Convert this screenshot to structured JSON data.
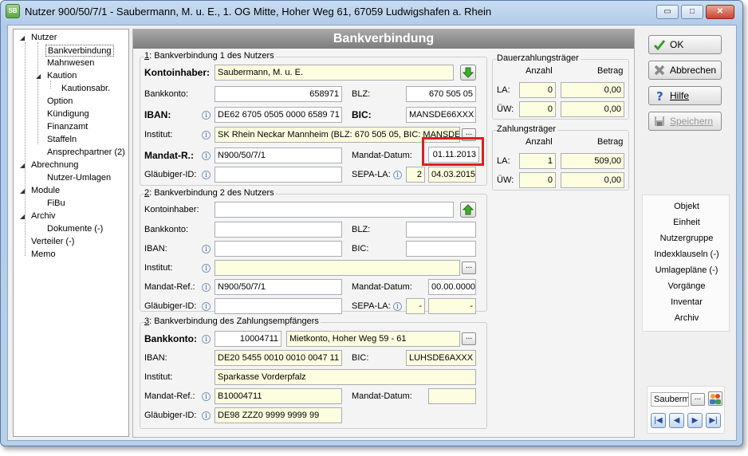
{
  "window": {
    "title": "Nutzer 900/50/7/1 - Saubermann, M. u. E., 1. OG Mitte, Hoher Weg 61, 67059 Ludwigshafen a. Rhein",
    "icon_label": "SB",
    "minimize": "▭",
    "maximize": "□",
    "close": "✕"
  },
  "tree": {
    "items": [
      {
        "label": "Nutzer",
        "toggle": "◢"
      },
      {
        "label": "Bankverbindung"
      },
      {
        "label": "Mahnwesen"
      },
      {
        "label": "Kaution",
        "toggle": "◢"
      },
      {
        "label": "Kautionsabr."
      },
      {
        "label": "Option"
      },
      {
        "label": "Kündigung"
      },
      {
        "label": "Finanzamt"
      },
      {
        "label": "Staffeln"
      },
      {
        "label": "Ansprechpartner (2)"
      },
      {
        "label": "Abrechnung",
        "toggle": "◢"
      },
      {
        "label": "Nutzer-Umlagen"
      },
      {
        "label": "Module",
        "toggle": "◢"
      },
      {
        "label": "FiBu"
      },
      {
        "label": "Archiv",
        "toggle": "◢"
      },
      {
        "label": "Dokumente (-)"
      },
      {
        "label": "Verteiler (-)"
      },
      {
        "label": "Memo"
      }
    ]
  },
  "main": {
    "title": "Bankverbindung"
  },
  "bank1": {
    "title_num": "1",
    "title_rest": ": Bankverbindung 1 des Nutzers",
    "kontoinhaber_label": "Kontoinhaber:",
    "kontoinhaber": "Saubermann, M. u. E.",
    "bankkonto_label": "Bankkonto:",
    "bankkonto": "658971",
    "blz_label": "BLZ:",
    "blz": "670 505 05",
    "iban_label": "IBAN:",
    "iban": "DE62 6705 0505 0000 6589 71",
    "bic_label": "BIC:",
    "bic": "MANSDE66XXX",
    "institut_label": "Institut:",
    "institut": "SK Rhein Neckar Mannheim  (BLZ: 670 505 05,  BIC: MANSDE",
    "mandat_ref_label": "Mandat-R.:",
    "mandat_ref": "N900/50/7/1",
    "mandat_datum_label": "Mandat-Datum:",
    "mandat_datum": "01.11.2013",
    "glaeubiger_label": "Gläubiger-ID:",
    "glaeubiger": "",
    "sepa_label": "SEPA-LA:",
    "sepa_count": "2",
    "sepa_date": "04.03.2015"
  },
  "bank2": {
    "title_num": "2",
    "title_rest": ": Bankverbindung 2 des Nutzers",
    "kontoinhaber_label": "Kontoinhaber:",
    "bankkonto_label": "Bankkonto:",
    "blz_label": "BLZ:",
    "iban_label": "IBAN:",
    "bic_label": "BIC:",
    "institut_label": "Institut:",
    "mandat_ref_label": "Mandat-Ref.:",
    "mandat_ref": "N900/50/7/1",
    "mandat_datum_label": "Mandat-Datum:",
    "mandat_datum": "00.00.0000",
    "glaeubiger_label": "Gläubiger-ID:",
    "sepa_label": "SEPA-LA:",
    "sepa_count": "-",
    "sepa_date": "-"
  },
  "bank3": {
    "title_num": "3",
    "title_rest": ": Bankverbindung des Zahlungsempfängers",
    "bankkonto_label": "Bankkonto:",
    "bankkonto": "10004711",
    "bankkonto_desc": "Mietkonto,  Hoher Weg 59 - 61",
    "iban_label": "IBAN:",
    "iban": "DE20 5455 0010 0010 0047 11",
    "bic_label": "BIC:",
    "bic": "LUHSDE6AXXX",
    "institut_label": "Institut:",
    "institut": "Sparkasse Vorderpfalz",
    "mandat_ref_label": "Mandat-Ref.:",
    "mandat_ref": "B10004711",
    "mandat_datum_label": "Mandat-Datum:",
    "glaeubiger_label": "Gläubiger-ID:",
    "glaeubiger": "DE98 ZZZ0 9999 9999 99"
  },
  "dauer": {
    "title": "Dauerzahlungsträger",
    "col_anzahl": "Anzahl",
    "col_betrag": "Betrag",
    "la_label": "LA:",
    "la_anzahl": "0",
    "la_betrag": "0,00",
    "uew_label": "ÜW:",
    "uew_anzahl": "0",
    "uew_betrag": "0,00"
  },
  "zahl": {
    "title": "Zahlungsträger",
    "col_anzahl": "Anzahl",
    "col_betrag": "Betrag",
    "la_label": "LA:",
    "la_anzahl": "1",
    "la_betrag": "509,00",
    "uew_label": "ÜW:",
    "uew_anzahl": "0",
    "uew_betrag": "0,00"
  },
  "actions": {
    "ok": "OK",
    "abbrechen": "Abbrechen",
    "hilfe": "Hilfe",
    "speichern": "Speichern"
  },
  "links": [
    "Objekt",
    "Einheit",
    "Nutzergruppe",
    "Indexklauseln (-)",
    "Umlagepläne (-)",
    "Vorgänge",
    "Inventar",
    "Archiv"
  ],
  "nav": {
    "search": "Sauberm",
    "dots": "...",
    "first": "|◀",
    "prev": "◀",
    "next": "▶",
    "last": "▶|"
  },
  "colors": {
    "accent_red": "#e21d1d",
    "field_yellow": "#fdfde0",
    "header_gray": "#8f8f8f"
  }
}
